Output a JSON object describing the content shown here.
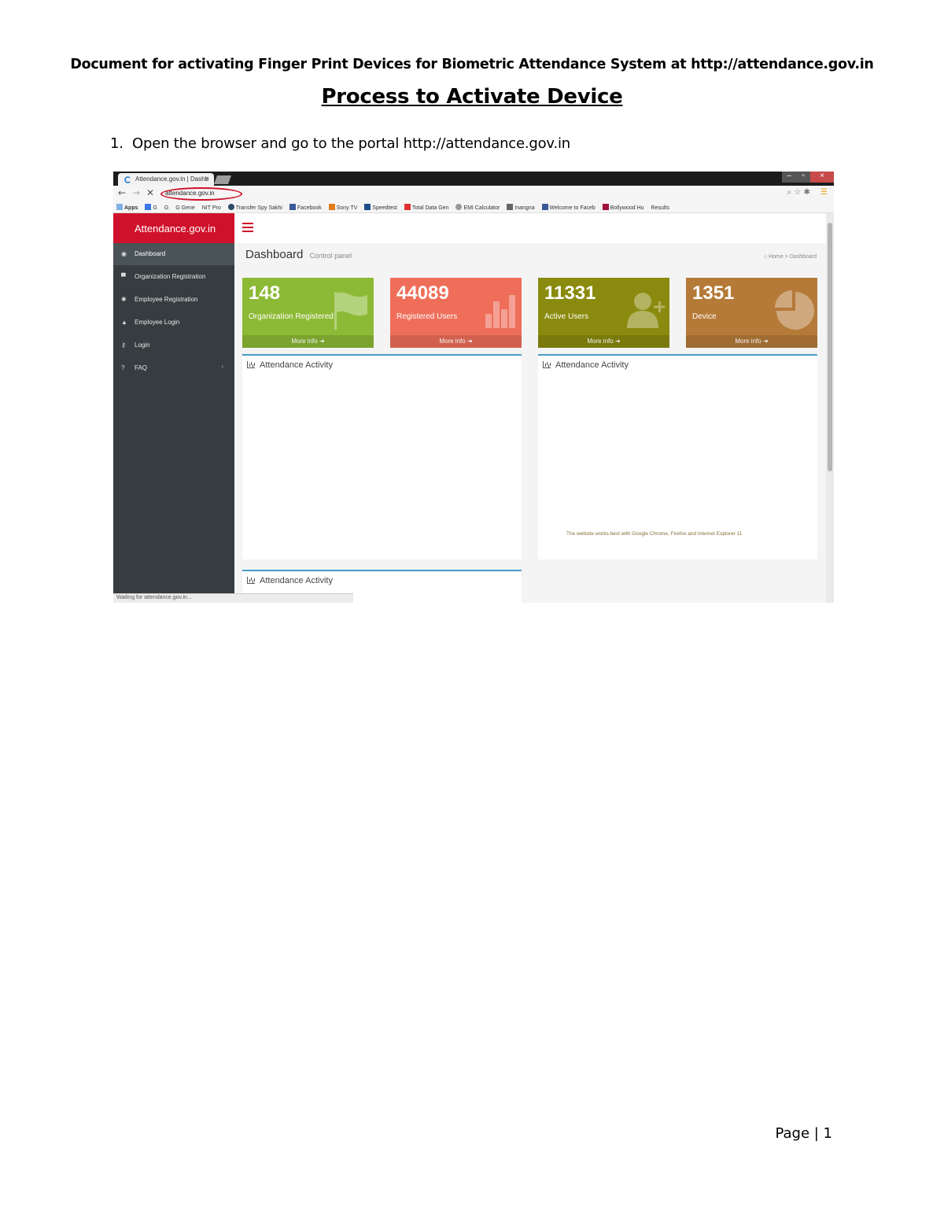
{
  "document": {
    "header": "Document for activating Finger Print Devices for Biometric Attendance System at http://attendance.gov.in",
    "title": "Process to Activate Device",
    "steps": [
      {
        "number": "1.",
        "text": "Open the browser and go to the portal http://attendance.gov.in"
      }
    ],
    "footer": "Page | 1"
  },
  "browser": {
    "tab_title": "Attendance.gov.in | Dashb",
    "tab_close": "×",
    "address": "attendance.gov.in",
    "window_controls": {
      "minimize": "–",
      "maximize": "▫",
      "close": "×"
    },
    "bookmarks": [
      "Apps",
      "G",
      "G",
      "G Gene",
      "NIT Pro",
      "Transfer Spy Sakhi",
      "Facebook",
      "Sony TV",
      "Speedtest",
      "Total Data Gen",
      "EMI Calculator",
      "Inangna",
      "Welcome to Faceb",
      "Bollywood Hu",
      "Results"
    ],
    "status": "Waiting for attendance.gov.in...",
    "accent_ring": "#d0112b"
  },
  "app": {
    "logo": "Attendance.gov.in",
    "sidebar": [
      {
        "label": "Dashboard",
        "icon": "dashboard-icon",
        "active": true
      },
      {
        "label": "Organization Registration",
        "icon": "building-icon"
      },
      {
        "label": "Employee Registration",
        "icon": "users-icon"
      },
      {
        "label": "Employee Login",
        "icon": "user-icon"
      },
      {
        "label": "Login",
        "icon": "key-icon"
      },
      {
        "label": "FAQ",
        "icon": "question-icon",
        "chevron": "‹"
      }
    ],
    "page_title": "Dashboard",
    "page_subtitle": "Control panel",
    "breadcrumb": [
      "Home",
      "Dashboard"
    ],
    "stats": [
      {
        "value": "148",
        "label": "Organization Registered",
        "more": "More info",
        "color": "#8dba36",
        "icon": "flag-icon"
      },
      {
        "value": "44089",
        "label": "Registered Users",
        "more": "More info",
        "color": "#ef6e5a",
        "icon": "bar-chart-icon"
      },
      {
        "value": "11331",
        "label": "Active Users",
        "more": "More info",
        "color": "#8a8a0e",
        "icon": "user-add-icon"
      },
      {
        "value": "1351",
        "label": "Device",
        "more": "More info",
        "color": "#b57a38",
        "icon": "pie-chart-icon"
      }
    ],
    "panels": [
      "Attendance Activity",
      "Attendance Activity",
      "Attendance Activity"
    ],
    "notice": "The website works best with Google Chrome, Firefox and Internet Explorer 11"
  }
}
